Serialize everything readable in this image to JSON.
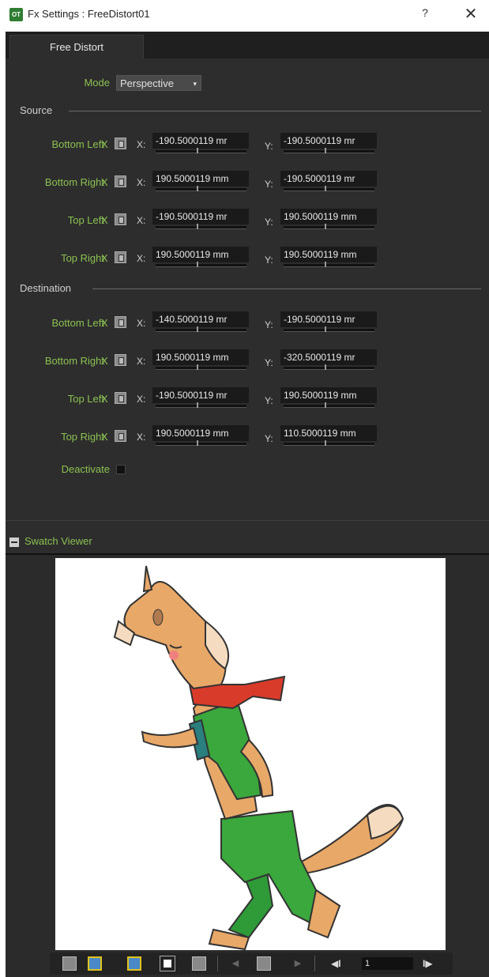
{
  "window": {
    "app_icon_text": "OT",
    "title": "Fx Settings : FreeDistort01",
    "help_label": "?",
    "close_label": "✕"
  },
  "tabs": [
    {
      "label": "Free Distort"
    }
  ],
  "mode": {
    "label": "Mode",
    "value": "Perspective",
    "arrow": "▾"
  },
  "source": {
    "title": "Source",
    "rows": [
      {
        "label": "Bottom Left",
        "x_label": "X",
        "axis_x": "X:",
        "x_value": "-190.5000119 mr",
        "axis_y": "Y:",
        "y_value": "-190.5000119 mr"
      },
      {
        "label": "Bottom Right",
        "x_label": "X",
        "axis_x": "X:",
        "x_value": "190.5000119 mm",
        "axis_y": "Y:",
        "y_value": "-190.5000119 mr"
      },
      {
        "label": "Top Left",
        "x_label": "X",
        "axis_x": "X:",
        "x_value": "-190.5000119 mr",
        "axis_y": "Y:",
        "y_value": "190.5000119 mm"
      },
      {
        "label": "Top Right",
        "x_label": "X",
        "axis_x": "X:",
        "x_value": "190.5000119 mm",
        "axis_y": "Y:",
        "y_value": "190.5000119 mm"
      }
    ]
  },
  "destination": {
    "title": "Destination",
    "rows": [
      {
        "label": "Bottom Left",
        "x_label": "X",
        "axis_x": "X:",
        "x_value": "-140.5000119 mr",
        "axis_y": "Y:",
        "y_value": "-190.5000119 mr"
      },
      {
        "label": "Bottom Right",
        "x_label": "X",
        "axis_x": "X:",
        "x_value": "190.5000119 mm",
        "axis_y": "Y:",
        "y_value": "-320.5000119 mr"
      },
      {
        "label": "Top Left",
        "x_label": "X",
        "axis_x": "X:",
        "x_value": "-190.5000119 mr",
        "axis_y": "Y:",
        "y_value": "190.5000119 mm"
      },
      {
        "label": "Top Right",
        "x_label": "X",
        "axis_x": "X:",
        "x_value": "190.5000119 mm",
        "axis_y": "Y:",
        "y_value": "110.5000119 mm"
      }
    ]
  },
  "deactivate": {
    "label": "Deactivate",
    "checked": false
  },
  "swatch": {
    "title": "Swatch Viewer"
  },
  "toolbar": {
    "frame_value": "1",
    "prev_frame": "◀I",
    "next_frame": "I▶",
    "prev_key": "◀",
    "next_key": "▶"
  },
  "colors": {
    "accent_green": "#8cc152",
    "panel_bg": "#2d2d2d",
    "field_bg": "#1a1a1a"
  }
}
